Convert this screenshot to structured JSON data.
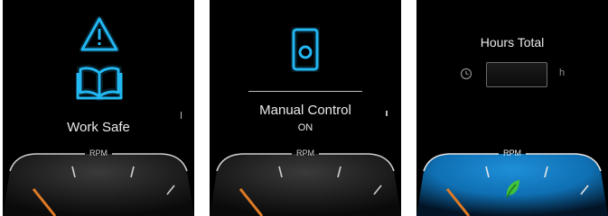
{
  "screens": [
    {
      "icons": [
        "warning-triangle-icon",
        "open-book-icon"
      ],
      "label": "Work Safe"
    },
    {
      "icons": [
        "phone-remote-icon"
      ],
      "label": "Manual Control",
      "status": "ON"
    },
    {
      "title": "Hours Total",
      "icons": [
        "clock-icon",
        "eco-leaf-icon"
      ],
      "value": "",
      "unit": "h"
    }
  ],
  "gauge": {
    "label": "RPM"
  },
  "colors": {
    "neon_blue": "#23b7f2",
    "needle": "#e07b26",
    "leaf": "#3fc23c",
    "gauge_glow": "#0f6fb2"
  }
}
